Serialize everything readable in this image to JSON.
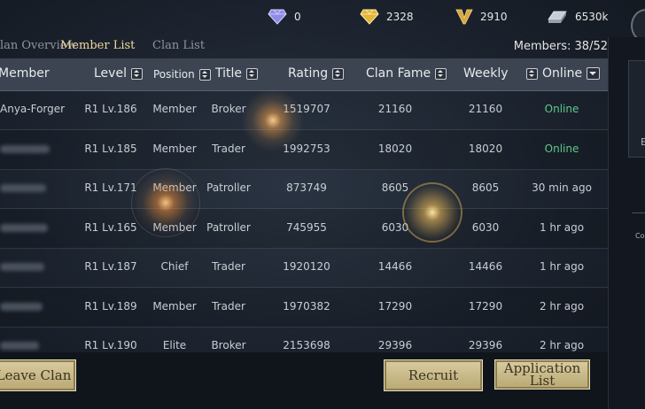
{
  "resources": [
    {
      "icon": "diamond-icon",
      "value": "0",
      "color": "#a9a6f5"
    },
    {
      "icon": "gold-gem-icon",
      "value": "2328",
      "color": "#e6b93c"
    },
    {
      "icon": "v-token-icon",
      "value": "2910",
      "color": "#d7a840"
    },
    {
      "icon": "silver-bar-icon",
      "value": "6530k",
      "color": "#c9ced6"
    }
  ],
  "tabs": [
    "Clan Overview",
    "Member List",
    "Clan List"
  ],
  "active_tab": 1,
  "members_count": "Members: 38/52",
  "right_panel": {
    "text1": "E",
    "text2": "Co"
  },
  "columns": {
    "member": "Member",
    "level": "Level",
    "position": "Position",
    "title": "Title",
    "rating": "Rating",
    "clan_fame": "Clan Fame",
    "weekly": "Weekly",
    "online": "Online"
  },
  "rows": [
    {
      "name": "Anya-Forger",
      "level": "R1 Lv.186",
      "position": "Member",
      "title": "Broker",
      "rating": "1519707",
      "fame": "21160",
      "weekly": "21160",
      "online": "Online",
      "is_online": true
    },
    {
      "name": "",
      "level": "R1 Lv.185",
      "position": "Member",
      "title": "Trader",
      "rating": "1992753",
      "fame": "18020",
      "weekly": "18020",
      "online": "Online",
      "is_online": true
    },
    {
      "name": "",
      "level": "R1 Lv.171",
      "position": "Member",
      "title": "Patroller",
      "rating": "873749",
      "fame": "8605",
      "weekly": "8605",
      "online": "30 min ago",
      "is_online": false
    },
    {
      "name": "",
      "level": "R1 Lv.165",
      "position": "Member",
      "title": "Patroller",
      "rating": "745955",
      "fame": "6030",
      "weekly": "6030",
      "online": "1 hr ago",
      "is_online": false
    },
    {
      "name": "",
      "level": "R1 Lv.187",
      "position": "Chief",
      "title": "Trader",
      "rating": "1920120",
      "fame": "14466",
      "weekly": "14466",
      "online": "1 hr ago",
      "is_online": false
    },
    {
      "name": "",
      "level": "R1 Lv.189",
      "position": "Member",
      "title": "Trader",
      "rating": "1970382",
      "fame": "17290",
      "weekly": "17290",
      "online": "2 hr ago",
      "is_online": false
    },
    {
      "name": "",
      "level": "R1 Lv.190",
      "position": "Elite",
      "title": "Broker",
      "rating": "2153698",
      "fame": "29396",
      "weekly": "29396",
      "online": "2 hr ago",
      "is_online": false
    }
  ],
  "buttons": {
    "leave": "Leave Clan",
    "recruit": "Recruit",
    "application": "Application List"
  },
  "colors": {
    "accent_gold": "#f0d89c",
    "online_green": "#5ec98a",
    "button_gold": "#d2c493"
  }
}
